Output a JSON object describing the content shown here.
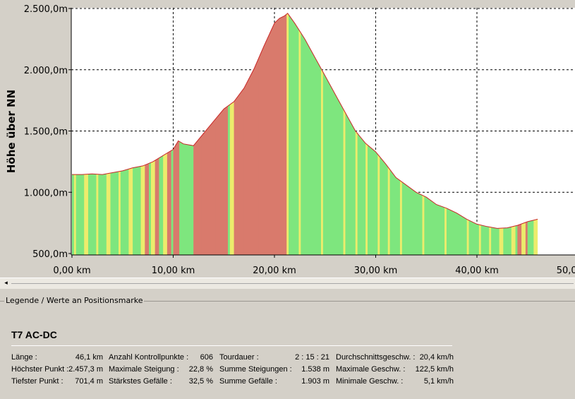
{
  "chart_data": {
    "type": "area",
    "xlabel": "",
    "ylabel": "Höhe über NN",
    "xlim": [
      0,
      50
    ],
    "ylim": [
      500,
      2500
    ],
    "x_ticks": [
      "0,00 km",
      "10,00 km",
      "20,00 km",
      "30,00 km",
      "40,00 km",
      "50,00 km"
    ],
    "y_ticks": [
      "500,0m",
      "1.000,0m",
      "1.500,0m",
      "2.000,0m",
      "2.500,0m"
    ],
    "grid": true,
    "x": [
      0,
      1,
      2,
      3,
      4,
      5,
      6,
      7,
      8,
      9,
      10,
      10.5,
      11,
      12,
      13,
      14,
      15,
      16,
      17,
      18,
      19,
      20,
      20.5,
      21,
      21.3,
      22,
      23,
      24,
      25,
      26,
      27,
      28,
      29,
      30,
      31,
      32,
      33,
      34,
      35,
      36,
      37,
      38,
      39,
      40,
      41,
      42,
      43,
      44,
      45,
      46
    ],
    "y": [
      1145,
      1145,
      1150,
      1145,
      1160,
      1175,
      1200,
      1215,
      1250,
      1300,
      1350,
      1420,
      1395,
      1380,
      1480,
      1580,
      1680,
      1740,
      1850,
      2010,
      2200,
      2380,
      2420,
      2440,
      2460,
      2380,
      2250,
      2100,
      1950,
      1800,
      1650,
      1500,
      1400,
      1330,
      1230,
      1120,
      1060,
      1000,
      960,
      900,
      870,
      830,
      780,
      740,
      720,
      705,
      710,
      730,
      760,
      780
    ],
    "colors": {
      "fill_green": "#7ee67e",
      "fill_yellow": "#ecec6c",
      "fill_red": "#d97a6c",
      "outline": "#c82828"
    }
  },
  "legend": {
    "caption": "Legende / Werte an Positionsmarke",
    "tour_name": "T7 AC-DC"
  },
  "stats": [
    {
      "label": "Länge :",
      "value": "46,1 km"
    },
    {
      "label": "Höchster Punkt :",
      "value": "2.457,3 m"
    },
    {
      "label": "Tiefster Punkt :",
      "value": "701,4 m"
    },
    {
      "label": "Anzahl Kontrollpunkte :",
      "value": "606"
    },
    {
      "label": "Maximale Steigung :",
      "value": "22,8 %"
    },
    {
      "label": "Stärkstes Gefälle :",
      "value": "32,5 %"
    },
    {
      "label": "Tourdauer :",
      "value": "2 : 15 : 21"
    },
    {
      "label": "Summe Steigungen :",
      "value": "1.538 m"
    },
    {
      "label": "Summe Gefälle :",
      "value": "1.903 m"
    },
    {
      "label": "Durchschnittsgeschw. :",
      "value": "20,4 km/h"
    },
    {
      "label": "Maximale Geschw. :",
      "value": "122,5 km/h"
    },
    {
      "label": "Minimale Geschw. :",
      "value": "5,1 km/h"
    }
  ],
  "scrollbar": {
    "left_arrow": "◂"
  }
}
